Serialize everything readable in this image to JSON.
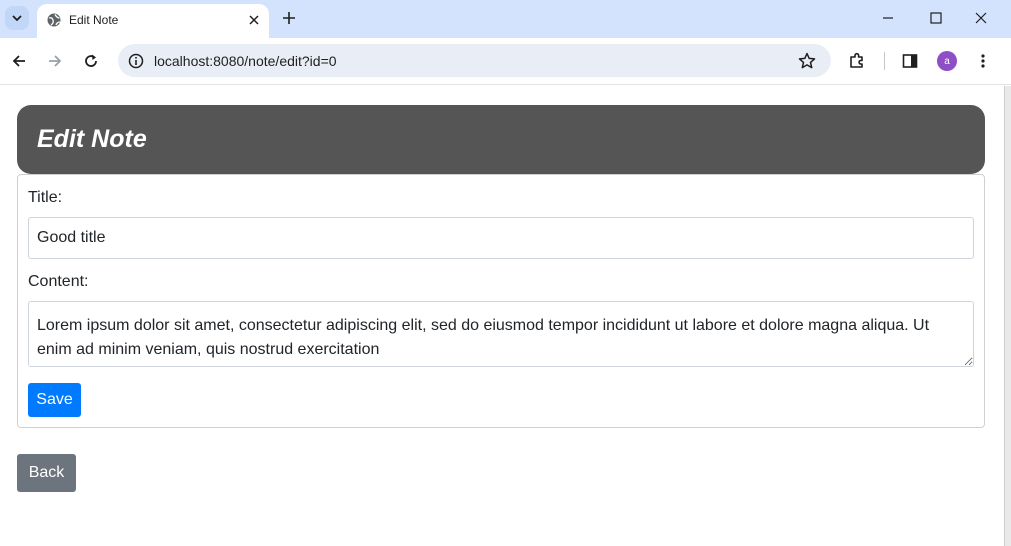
{
  "browser": {
    "tab_title": "Edit Note",
    "url": "localhost:8080/note/edit?id=0",
    "profile_initial": "a",
    "profile_color": "#8e4ec6"
  },
  "page": {
    "heading": "Edit Note",
    "title_label": "Title:",
    "title_value": "Good title",
    "content_label": "Content:",
    "content_value": "Lorem ipsum dolor sit amet, consectetur adipiscing elit, sed do eiusmod tempor incididunt ut labore et dolore magna aliqua. Ut enim ad minim veniam, quis nostrud exercitation",
    "save_label": "Save",
    "back_label": "Back"
  },
  "colors": {
    "header_bg": "#555555",
    "save_bg": "#007bff",
    "back_bg": "#6c757d"
  }
}
